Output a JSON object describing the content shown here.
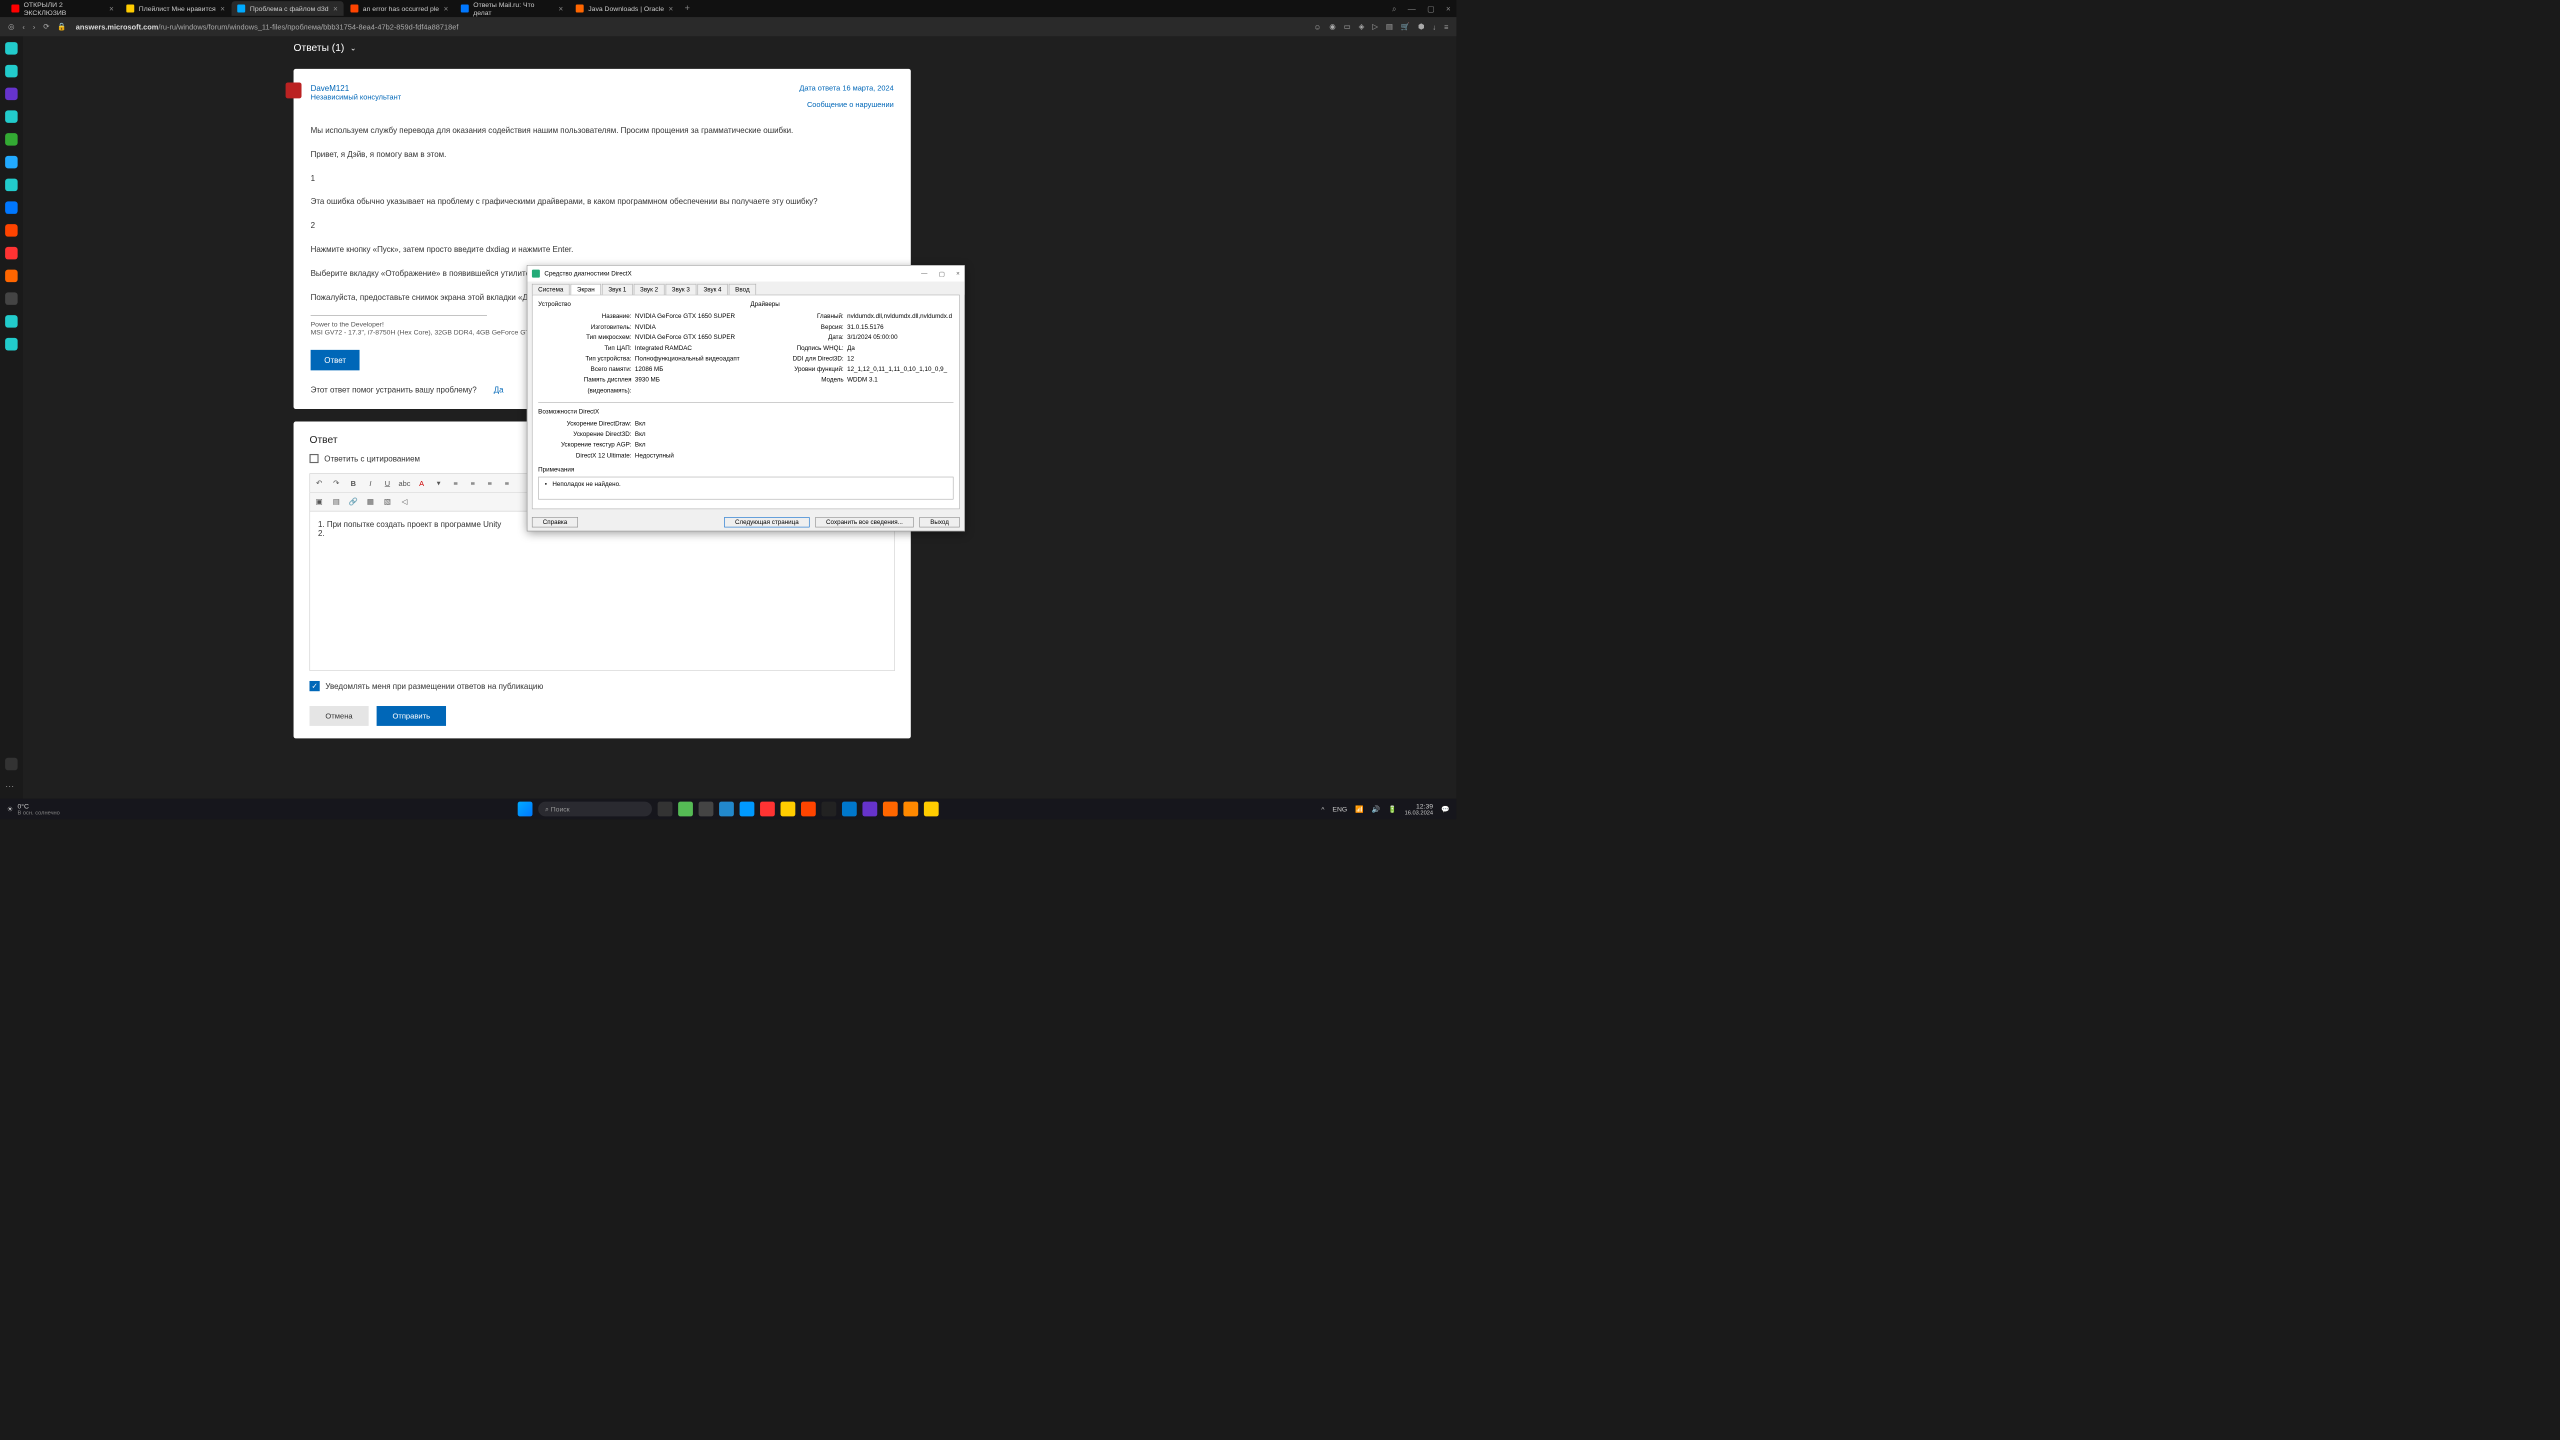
{
  "tabs": [
    {
      "label": "ОТКРЫЛИ 2 ЭКСКЛЮЗИВ",
      "fav": "#f00"
    },
    {
      "label": "Плейлист Мне нравится",
      "fav": "#fc0"
    },
    {
      "label": "Проблема с файлом d3d",
      "fav": "#0af",
      "active": true
    },
    {
      "label": "an error has occurred ple",
      "fav": "#f40"
    },
    {
      "label": "Ответы Mail.ru: Что делат",
      "fav": "#07f"
    },
    {
      "label": "Java Downloads | Oracle",
      "fav": "#f60"
    }
  ],
  "url": {
    "host": "answers.microsoft.com",
    "path": "/ru-ru/windows/forum/windows_11-files/проблема/bbb31754-8ea4-47b2-859d-fdf4a88718ef"
  },
  "answers_header": "Ответы (1)",
  "author": {
    "name": "DaveM121",
    "role": "Независимый консультант"
  },
  "meta": {
    "date": "Дата ответа 16 марта, 2024",
    "report": "Сообщение о нарушении"
  },
  "post": {
    "l1": "Мы используем службу перевода для оказания содействия нашим пользователям. Просим прощения за грамматические ошибки.",
    "l2": "Привет, я Дэйв, я помогу вам в этом.",
    "l3": "1",
    "l4": "Эта ошибка обычно указывает на проблему с графическими драйверами, в каком программном обеспечении вы получаете эту ошибку?",
    "l5": "2",
    "l6": "Нажмите кнопку «Пуск», затем просто введите dxdiag и нажмите Enter.",
    "l7": "Выберите вкладку «Отображение» в появившейся утилите DirectX.",
    "l8": "Пожалуйста, предоставьте снимок экрана этой вкладки «Дисплей»."
  },
  "sig": {
    "l1": "Power to the Developer!",
    "l2": "MSI GV72 - 17.3\", i7-8750H (Hex Core), 32GB DDR4, 4GB GeForce GTX 1"
  },
  "buttons": {
    "reply": "Ответ",
    "yes": "Да",
    "cancel": "Отмена",
    "send": "Отправить"
  },
  "helpful": "Этот ответ помог устранить вашу проблему?",
  "editor": {
    "title": "Ответ",
    "quote": "Ответить с цитированием",
    "content1": "1. При попытке создать проект в программе Unity",
    "content2": "2.",
    "notify": "Уведомлять меня при размещении ответов на публикацию"
  },
  "dx": {
    "title": "Средство диагностики DirectX",
    "tabs": [
      "Система",
      "Экран",
      "Звук 1",
      "Звук 2",
      "Звук 3",
      "Звук 4",
      "Ввод"
    ],
    "device_title": "Устройство",
    "driver_title": "Драйверы",
    "device": [
      {
        "lbl": "Название:",
        "val": "NVIDIA GeForce GTX 1650 SUPER"
      },
      {
        "lbl": "Изготовитель:",
        "val": "NVIDIA"
      },
      {
        "lbl": "Тип микросхем:",
        "val": "NVIDIA GeForce GTX 1650 SUPER"
      },
      {
        "lbl": "Тип ЦАП:",
        "val": "Integrated RAMDAC"
      },
      {
        "lbl": "Тип устройства:",
        "val": "Полнофункциональный видеоадапт"
      },
      {
        "lbl": "Всего памяти:",
        "val": "12086 МБ"
      },
      {
        "lbl": "Память дисплея (видеопамять):",
        "val": "3930 МБ"
      }
    ],
    "driver": [
      {
        "lbl": "Главный:",
        "val": "nvldumdx.dll,nvldumdx.dll,nvldumdx.d"
      },
      {
        "lbl": "Версия:",
        "val": "31.0.15.5176"
      },
      {
        "lbl": "Дата:",
        "val": "3/1/2024 05:00:00"
      },
      {
        "lbl": "Подпись WHQL:",
        "val": "Да"
      },
      {
        "lbl": "DDI для Direct3D:",
        "val": "12"
      },
      {
        "lbl": "Уровни функций:",
        "val": "12_1,12_0,11_1,11_0,10_1,10_0,9_"
      },
      {
        "lbl": "Модель",
        "val": "WDDM 3.1"
      }
    ],
    "features_title": "Возможности DirectX",
    "features": [
      {
        "lbl": "Ускорение DirectDraw:",
        "val": "Вкл"
      },
      {
        "lbl": "Ускорение Direct3D:",
        "val": "Вкл"
      },
      {
        "lbl": "Ускорение текстур AGP:",
        "val": "Вкл"
      },
      {
        "lbl": "DirectX 12 Ultimate:",
        "val": "Недоступный"
      }
    ],
    "notes_title": "Примечания",
    "notes": "Неполадок не найдено.",
    "btns": {
      "help": "Справка",
      "next": "Следующая страница",
      "save": "Сохранить все сведения...",
      "exit": "Выход"
    }
  },
  "taskbar": {
    "temp": "0°C",
    "weather": "В осн. солнечно",
    "search": "Поиск",
    "lang": "ENG",
    "time": "12:39",
    "date": "16.03.2024"
  }
}
